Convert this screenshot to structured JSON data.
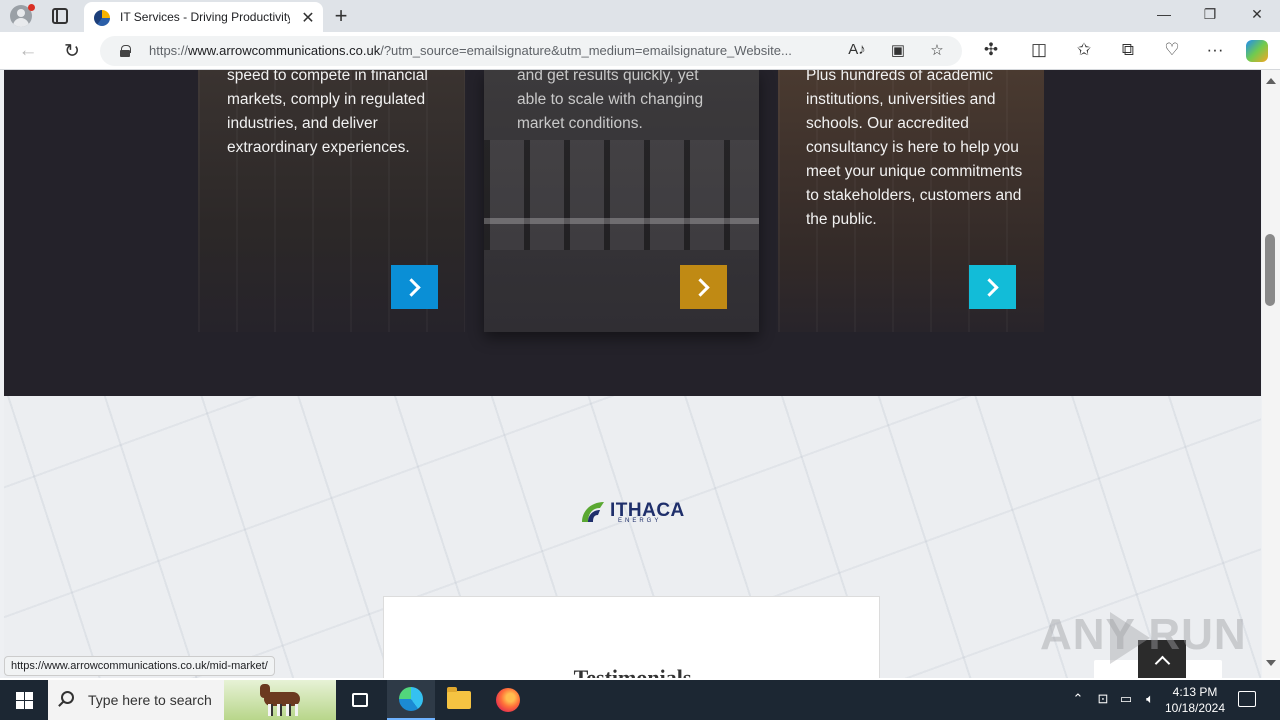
{
  "browser": {
    "tab_title": "IT Services - Driving Productivity",
    "url_prefix": "https://",
    "url_domain": "www.arrowcommunications.co.uk",
    "url_rest": "/?utm_source=emailsignature&utm_medium=emailsignature_Website...",
    "status_url": "https://www.arrowcommunications.co.uk/mid-market/"
  },
  "cards": [
    {
      "text": "speed to compete in financial markets, comply in regulated industries, and deliver extraordinary experiences.",
      "button_color": "#0a8fd6"
    },
    {
      "text": "and get results quickly, yet able to scale with changing market conditions.",
      "button_color": "#c08a14"
    },
    {
      "text": "Plus hundreds of academic institutions, universities and schools. Our accredited consultancy is here to help you meet your unique commitments to stakeholders, customers and the public.",
      "button_color": "#12bcd8"
    }
  ],
  "logo": {
    "name": "ITHACA",
    "sub": "ENERGY"
  },
  "testimonials": {
    "title": "Testimonials"
  },
  "watermark": "ANY RUN",
  "taskbar": {
    "search_placeholder": "Type here to search",
    "time": "4:13 PM",
    "date": "10/18/2024"
  },
  "icons": {
    "back": "back-arrow-icon",
    "refresh": "refresh-icon",
    "lock": "lock-icon",
    "read_aloud": "read-aloud-icon",
    "immersive_reader": "immersive-reader-icon",
    "favorite": "star-icon",
    "extensions": "puzzle-icon",
    "split_screen": "split-screen-icon",
    "favorites": "favorites-icon",
    "collections": "collections-icon",
    "browser_essentials": "heart-pulse-icon",
    "more": "ellipsis-icon",
    "copilot": "copilot-icon"
  }
}
